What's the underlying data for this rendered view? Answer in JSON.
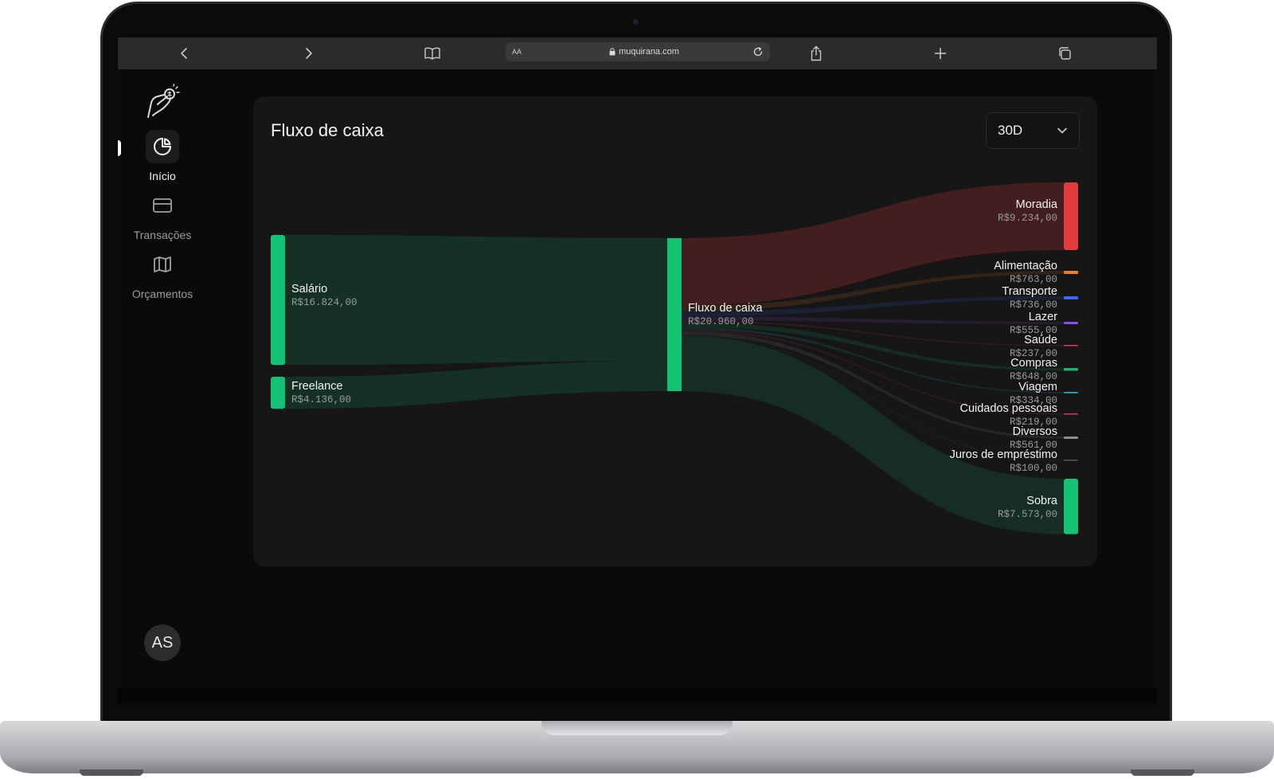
{
  "browser": {
    "url": "muquirana.com",
    "text_size_label": "AA"
  },
  "sidebar": {
    "items": [
      {
        "label": "Início",
        "icon": "pie-chart-icon",
        "active": true
      },
      {
        "label": "Transações",
        "icon": "credit-card-icon",
        "active": false
      },
      {
        "label": "Orçamentos",
        "icon": "map-icon",
        "active": false
      }
    ],
    "avatar_initials": "AS"
  },
  "card": {
    "title": "Fluxo de caixa",
    "period": "30D"
  },
  "colors": {
    "income": "#14c274",
    "moradia": "#e23b3b",
    "alimentacao": "#f07a22",
    "transporte": "#3a6cf0",
    "lazer": "#8b4cf0",
    "saude": "#e03d5e",
    "compras": "#17b86e",
    "viagem": "#1fb1b9",
    "cuidados": "#d8356c",
    "diversos": "#8c8c8c",
    "juros": "#555555",
    "sobra": "#14c274"
  },
  "chart_data": {
    "type": "sankey",
    "title": "Fluxo de caixa",
    "sources": [
      {
        "name": "Salário",
        "value": 16824,
        "label": "R$16.824,00"
      },
      {
        "name": "Freelance",
        "value": 4136,
        "label": "R$4.136,00"
      }
    ],
    "hub": {
      "name": "Fluxo de caixa",
      "value": 20960,
      "label": "R$20.960,00"
    },
    "targets": [
      {
        "name": "Moradia",
        "value": 9234,
        "label": "R$9.234,00",
        "color": "#e23b3b"
      },
      {
        "name": "Alimentação",
        "value": 763,
        "label": "R$763,00",
        "color": "#f07a22"
      },
      {
        "name": "Transporte",
        "value": 736,
        "label": "R$736,00",
        "color": "#3a6cf0"
      },
      {
        "name": "Lazer",
        "value": 555,
        "label": "R$555,00",
        "color": "#8b4cf0"
      },
      {
        "name": "Saúde",
        "value": 237,
        "label": "R$237,00",
        "color": "#e03d5e"
      },
      {
        "name": "Compras",
        "value": 648,
        "label": "R$648,00",
        "color": "#17b86e"
      },
      {
        "name": "Viagem",
        "value": 334,
        "label": "R$334,00",
        "color": "#1fb1b9"
      },
      {
        "name": "Cuidados pessoais",
        "value": 219,
        "label": "R$219,00",
        "color": "#d8356c"
      },
      {
        "name": "Diversos",
        "value": 561,
        "label": "R$561,00",
        "color": "#8c8c8c"
      },
      {
        "name": "Juros de empréstimo",
        "value": 100,
        "label": "R$100,00",
        "color": "#555555"
      },
      {
        "name": "Sobra",
        "value": 7573,
        "label": "R$7.573,00",
        "color": "#14c274"
      }
    ]
  }
}
